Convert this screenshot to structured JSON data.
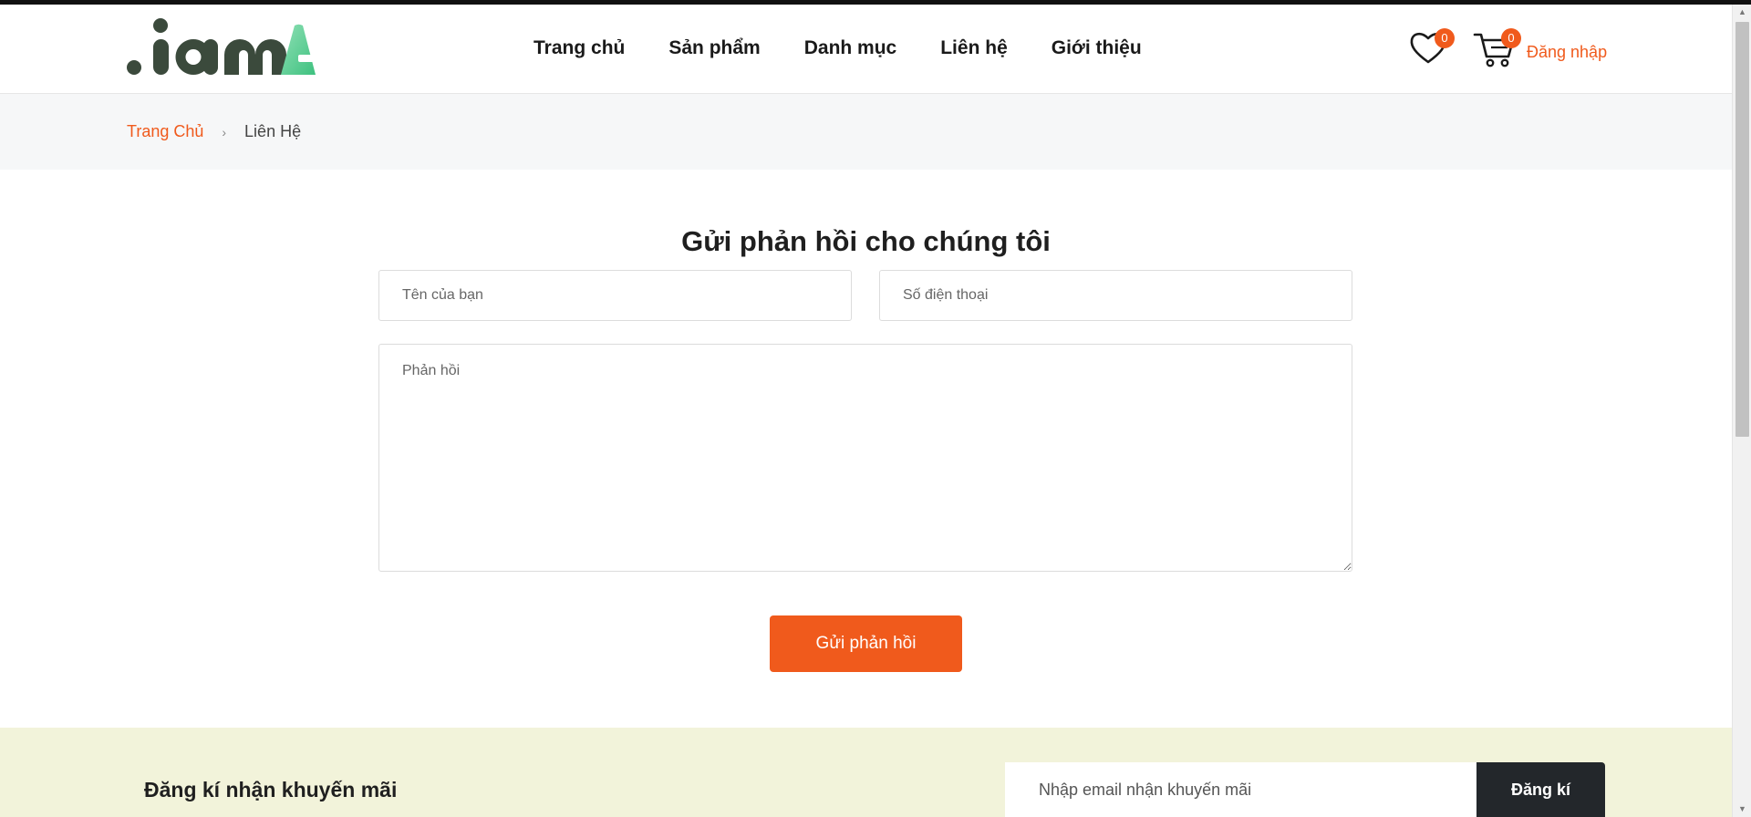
{
  "header": {
    "logo_text": ".iamA",
    "nav": [
      {
        "label": "Trang chủ"
      },
      {
        "label": "Sản phẩm"
      },
      {
        "label": "Danh mục"
      },
      {
        "label": "Liên hệ"
      },
      {
        "label": "Giới thiệu"
      }
    ],
    "wishlist_count": "0",
    "cart_count": "0",
    "login_label": "Đăng nhập"
  },
  "breadcrumb": {
    "home": "Trang Chủ",
    "separator": "›",
    "current": "Liên Hệ"
  },
  "form": {
    "title": "Gửi phản hồi cho chúng tôi",
    "name_placeholder": "Tên của bạn",
    "phone_placeholder": "Số điện thoại",
    "feedback_placeholder": "Phản hồi",
    "submit_label": "Gửi phản hồi"
  },
  "newsletter": {
    "title": "Đăng kí nhận khuyến mãi",
    "email_placeholder": "Nhập email nhận khuyến mãi",
    "subscribe_label": "Đăng kí"
  },
  "colors": {
    "accent": "#f05a1c",
    "logo_dark": "#3b4a3c",
    "logo_green": "#5fcf8f",
    "newsletter_bg": "#f2f3da",
    "dark_button": "#23272b"
  },
  "icons": {
    "wishlist": "heart-icon",
    "cart": "cart-icon"
  }
}
